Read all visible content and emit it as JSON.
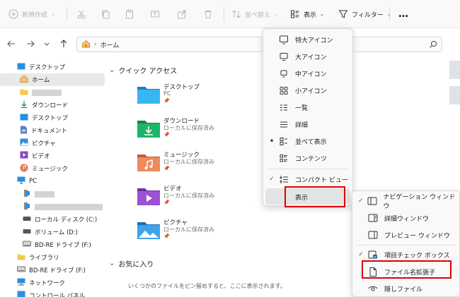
{
  "toolbar": {
    "new_label": "新規作成",
    "sort_label": "並べ替え",
    "view_label": "表示",
    "filter_label": "フィルター",
    "more_label": "…"
  },
  "address": {
    "path_label": "ホーム"
  },
  "sidebar": {
    "items": [
      {
        "label": "デスクトップ"
      },
      {
        "label": "ホーム"
      },
      {
        "label": ""
      },
      {
        "label": "ダウンロード"
      },
      {
        "label": "デスクトップ"
      },
      {
        "label": "ドキュメント"
      },
      {
        "label": "ピクチャ"
      },
      {
        "label": "ビデオ"
      },
      {
        "label": "ミュージック"
      },
      {
        "label": "PC"
      },
      {
        "label": ""
      },
      {
        "label": ""
      },
      {
        "label": "ローカル ディスク (C:)"
      },
      {
        "label": "ボリューム (D:)"
      },
      {
        "label": "BD-RE ドライブ (F:)"
      },
      {
        "label": "ライブラリ"
      },
      {
        "label": "BD-RE ドライブ (F:)"
      },
      {
        "label": "ネットワーク"
      },
      {
        "label": "コントロール パネル"
      }
    ]
  },
  "quick_access": {
    "title": "クイック アクセス",
    "items": [
      {
        "name": "デスクトップ",
        "sub": "PC"
      },
      {
        "name": "ダウンロード",
        "sub": "ローカルに保存済み"
      },
      {
        "name": "ミュージック",
        "sub": "ローカルに保存済み"
      },
      {
        "name": "ビデオ",
        "sub": "ローカルに保存済み"
      },
      {
        "name": "ピクチャ",
        "sub": "ローカルに保存済み"
      }
    ]
  },
  "favorites": {
    "title": "お気に入り",
    "empty_text": "いくつかのファイルをピン留めすると、ここに表示されます。"
  },
  "view_menu": {
    "items": [
      {
        "label": "特大アイコン",
        "checked": false
      },
      {
        "label": "大アイコン",
        "checked": false
      },
      {
        "label": "中アイコン",
        "checked": false
      },
      {
        "label": "小アイコン",
        "checked": false
      },
      {
        "label": "一覧",
        "checked": false
      },
      {
        "label": "詳細",
        "checked": false
      },
      {
        "label": "並べて表示",
        "checked": true
      },
      {
        "label": "コンテンツ",
        "checked": false
      },
      {
        "label": "コンパクト ビュー",
        "checked": true
      },
      {
        "label": "表示",
        "checked": false
      }
    ]
  },
  "show_submenu": {
    "items": [
      {
        "label": "ナビゲーション ウィンドウ",
        "checked": true
      },
      {
        "label": "詳細ウィンドウ",
        "checked": false
      },
      {
        "label": "プレビュー ウィンドウ",
        "checked": false
      },
      {
        "label": "項目チェック ボックス",
        "checked": true
      },
      {
        "label": "ファイル名拡張子",
        "checked": false
      },
      {
        "label": "隠しファイル",
        "checked": false
      }
    ]
  },
  "colors": {
    "accent": "#0067c0",
    "highlight_box": "#e00000",
    "folder_blue": "#1e8fd8",
    "folder_green": "#1d9e5c",
    "folder_orange": "#e0734b",
    "folder_purple": "#8a45c5",
    "folder_picture": "#2b8bd9"
  }
}
